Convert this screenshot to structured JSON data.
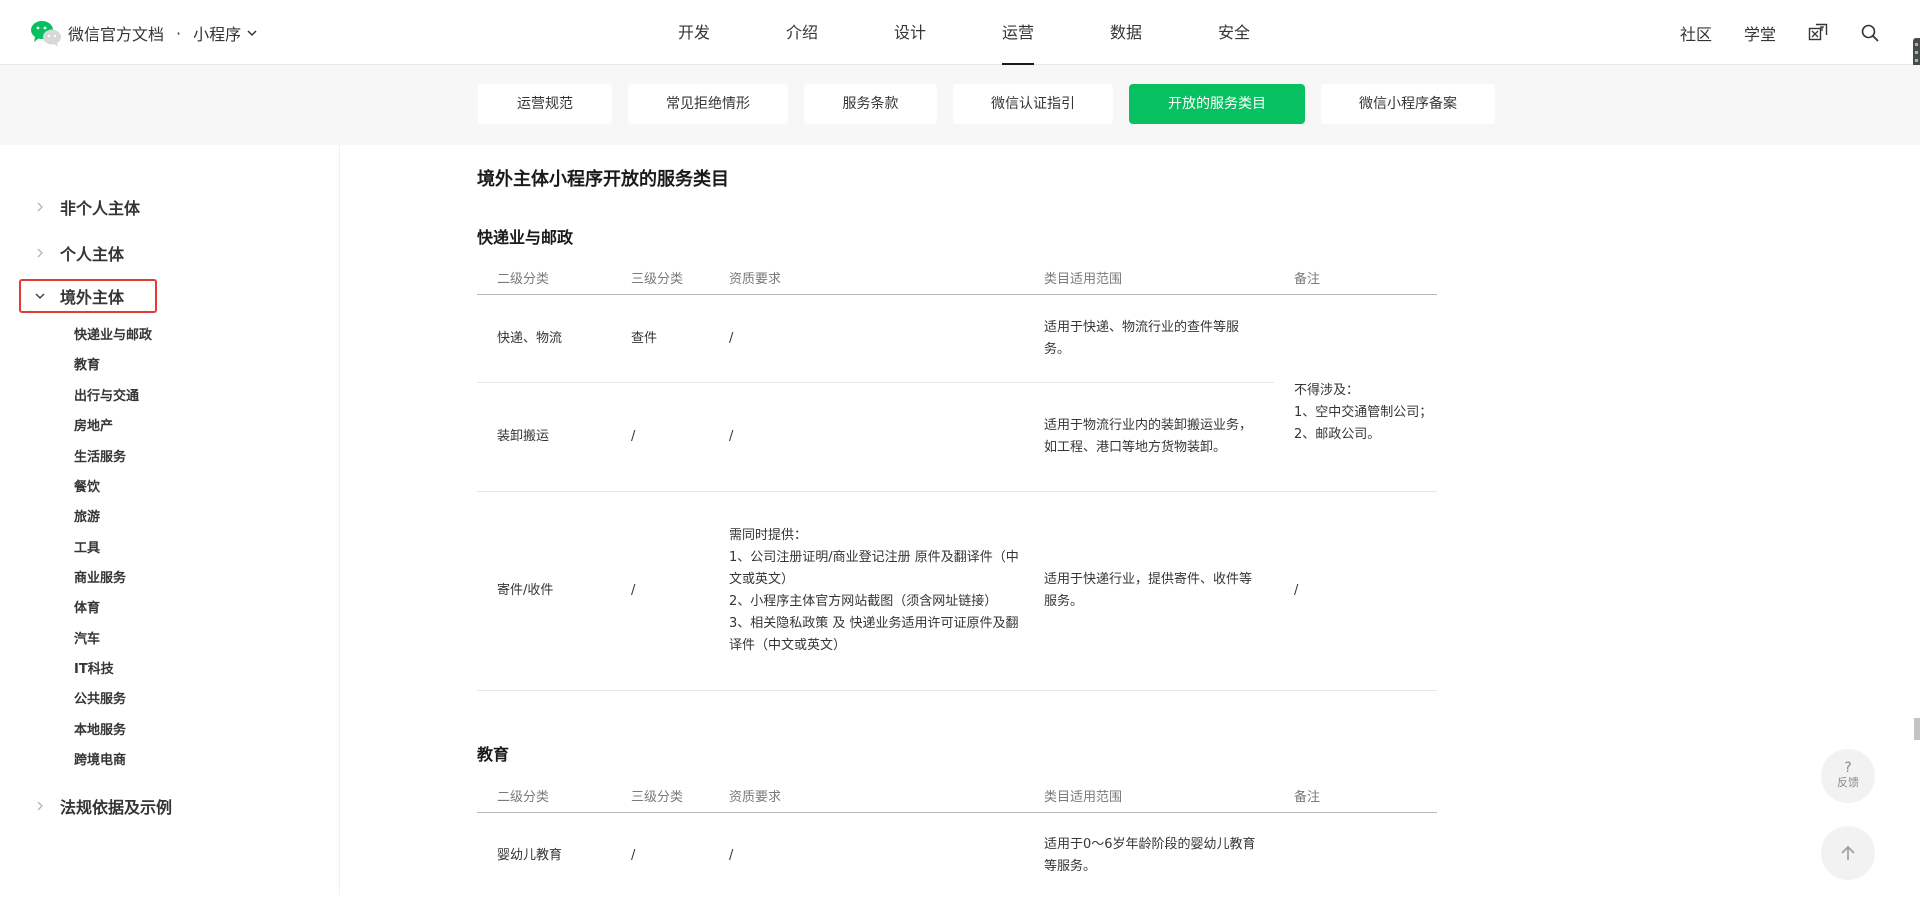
{
  "header": {
    "brand_title": "微信官方文档",
    "brand_dot": "·",
    "product": "小程序",
    "nav": [
      "开发",
      "介绍",
      "设计",
      "运营",
      "数据",
      "安全"
    ],
    "active_nav": "运营",
    "right_links": [
      "社区",
      "学堂"
    ],
    "icons": [
      "wechat-logo-icon",
      "chevron-down-icon",
      "translate-icon",
      "search-icon"
    ]
  },
  "subnav": {
    "tabs": [
      "运营规范",
      "常见拒绝情形",
      "服务条款",
      "微信认证指引",
      "开放的服务类目",
      "微信小程序备案"
    ],
    "active_tab": "开放的服务类目"
  },
  "sidebar": {
    "items": [
      {
        "label": "非个人主体",
        "expanded": false
      },
      {
        "label": "个人主体",
        "expanded": false
      },
      {
        "label": "境外主体",
        "expanded": true
      },
      {
        "label": "法规依据及示例",
        "expanded": false
      }
    ],
    "subitems": [
      "快递业与邮政",
      "教育",
      "出行与交通",
      "房地产",
      "生活服务",
      "餐饮",
      "旅游",
      "工具",
      "商业服务",
      "体育",
      "汽车",
      "IT科技",
      "公共服务",
      "本地服务",
      "跨境电商"
    ],
    "highlight_color": "#e23b36"
  },
  "content": {
    "title": "境外主体小程序开放的服务类目",
    "columns": [
      "二级分类",
      "三级分类",
      "资质要求",
      "类目适用范围",
      "备注"
    ],
    "sections": [
      {
        "heading": "快递业与邮政",
        "rows": [
          {
            "c1": "快递、物流",
            "c2": "查件",
            "c3": "/",
            "c4": "适用于快递、物流行业的查件等服务。"
          },
          {
            "c1": "装卸搬运",
            "c2": "/",
            "c3": "/",
            "c4": "适用于物流行业内的装卸搬运业务，如工程、港口等地方货物装卸。"
          },
          {
            "c1": "寄件/收件",
            "c2": "/",
            "c3": "需同时提供：\n1、公司注册证明/商业登记注册 原件及翻译件（中文或英文）\n2、小程序主体官方网站截图（须含网址链接）\n3、相关隐私政策 及 快递业务适用许可证原件及翻译件（中文或英文）",
            "c4": "适用于快递行业，提供寄件、收件等服务。",
            "c5": "/"
          }
        ],
        "merged_note": "不得涉及：\n1、空中交通管制公司；\n2、邮政公司。"
      },
      {
        "heading": "教育",
        "rows": [
          {
            "c1": "婴幼儿教育",
            "c2": "/",
            "c3": "/",
            "c4": "适用于0～6岁年龄阶段的婴幼儿教育等服务。"
          }
        ]
      }
    ]
  },
  "floating": {
    "help_mark": "?",
    "feedback": "反馈",
    "icons": [
      "back-to-top-icon"
    ]
  },
  "colors": {
    "accent": "#07c160",
    "subnav_bg": "#f7f7f7",
    "text": "#353535"
  }
}
